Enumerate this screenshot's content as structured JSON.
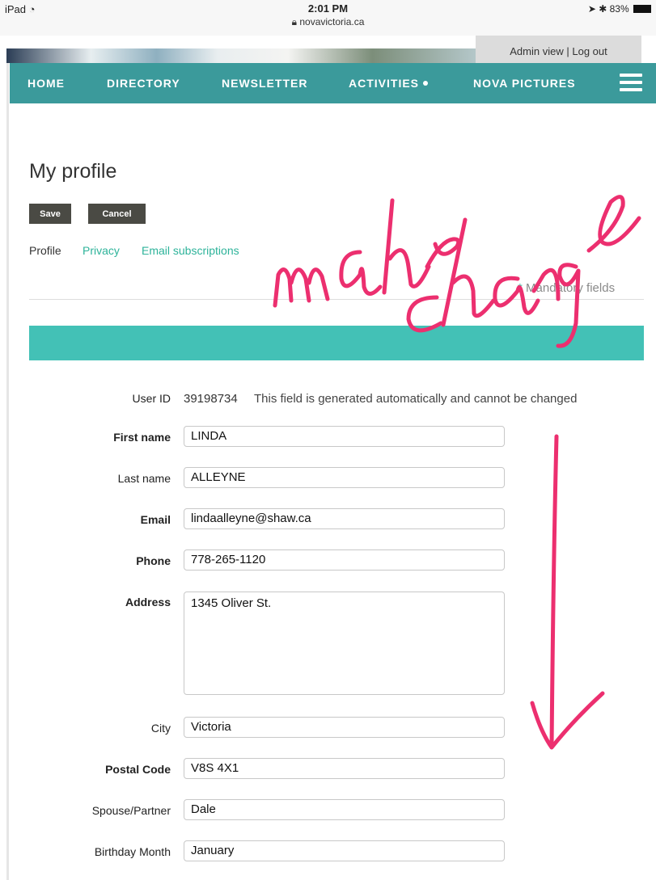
{
  "status_bar": {
    "device": "iPad",
    "wifi_icon": "wifi-icon",
    "time": "2:01 PM",
    "url": "novavictoria.ca",
    "battery": "83%"
  },
  "admin": {
    "admin_view": "Admin view",
    "separator": "|",
    "logout": "Log out"
  },
  "nav": {
    "items": [
      "HOME",
      "DIRECTORY",
      "NEWSLETTER",
      "ACTIVITIES",
      "NOVA PICTURES"
    ],
    "menu_icon": "hamburger-icon",
    "color": "#3b9a9b"
  },
  "page": {
    "title": "My profile",
    "save_label": "Save",
    "cancel_label": "Cancel",
    "tabs": [
      "Profile",
      "Privacy",
      "Email subscriptions"
    ],
    "mandatory_star": "*",
    "mandatory_text": "Mandatory fields",
    "accent": "#43c1b6"
  },
  "form": {
    "user_id_label": "User ID",
    "user_id_value": "39198734",
    "user_id_note": "This field is generated automatically and cannot be changed",
    "fields": [
      {
        "label": "First name",
        "value": "LINDA"
      },
      {
        "label": "Last name",
        "value": "ALLEYNE"
      },
      {
        "label": "Email",
        "value": "lindaalleyne@shaw.ca"
      },
      {
        "label": "Phone",
        "value": "778-265-1120"
      },
      {
        "label": "Address",
        "value": "1345 Oliver St."
      },
      {
        "label": "City",
        "value": "Victoria"
      },
      {
        "label": "Postal Code",
        "value": "V8S 4X1"
      },
      {
        "label": "Spouse/Partner",
        "value": "Dale"
      },
      {
        "label": "Birthday Month",
        "value": "January"
      }
    ]
  },
  "annotation": {
    "text": "make changes",
    "color": "#ec2f6f"
  }
}
